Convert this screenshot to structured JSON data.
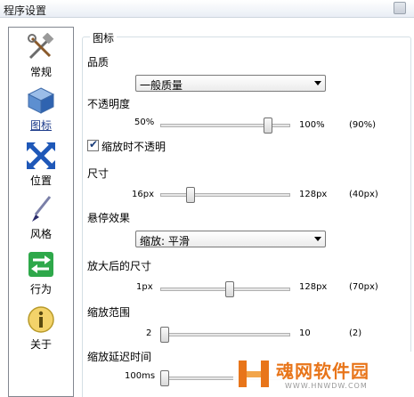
{
  "window": {
    "title": "程序设置"
  },
  "sidebar": {
    "items": [
      {
        "label": "常规",
        "icon": "tools-icon"
      },
      {
        "label": "图标",
        "icon": "package-icon",
        "active": true
      },
      {
        "label": "位置",
        "icon": "move-arrows-icon"
      },
      {
        "label": "风格",
        "icon": "brush-icon"
      },
      {
        "label": "行为",
        "icon": "swap-arrows-icon"
      },
      {
        "label": "关于",
        "icon": "info-icon"
      }
    ]
  },
  "icons_group": {
    "title": "图标",
    "quality": {
      "label": "品质",
      "value": "一般质量"
    },
    "opacity": {
      "label": "不透明度",
      "min": "50%",
      "max": "100%",
      "value": "(90%)",
      "fraction": 0.85
    },
    "opaque_on_zoom": {
      "label": "缩放时不透明",
      "checked": true
    },
    "size": {
      "label": "尺寸",
      "min": "16px",
      "max": "128px",
      "value": "(40px)",
      "fraction": 0.21
    },
    "hover_effect": {
      "label": "悬停效果",
      "value": "缩放: 平滑"
    },
    "zoomed_size": {
      "label": "放大后的尺寸",
      "min": "1px",
      "max": "128px",
      "value": "(70px)",
      "fraction": 0.54
    },
    "zoom_range": {
      "label": "缩放范围",
      "min": "2",
      "max": "10",
      "value": "(2)",
      "fraction": 0.0
    },
    "zoom_delay": {
      "label": "缩放延迟时间",
      "min": "100ms"
    }
  },
  "watermark": {
    "text": "魂网软件园",
    "url": "WWW.HNWDW.COM"
  },
  "colors": {
    "accent": "#1b3a8a",
    "border": "#828790",
    "watermark": "#e8751a"
  }
}
